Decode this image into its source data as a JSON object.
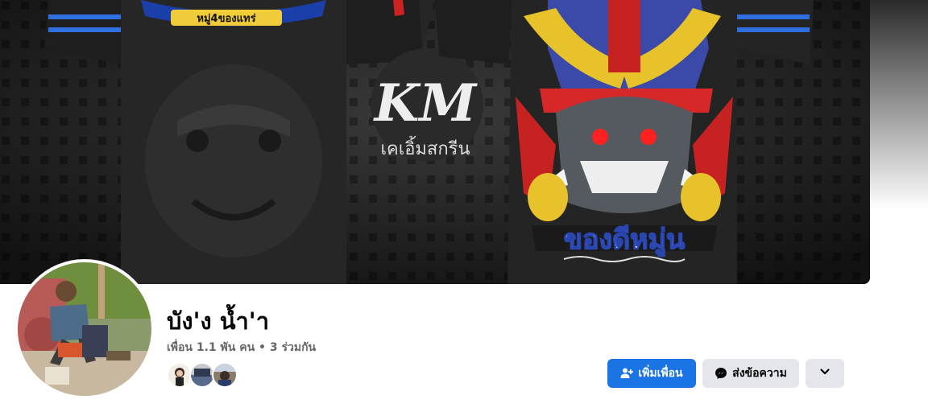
{
  "profile": {
    "name": "บัง'ง น้ำ'า",
    "friends_summary": "เพื่อน 1.1 พัน คน • 3 ร่วมกัน",
    "mutual_friend_count_shown": 3
  },
  "cover": {
    "brand_mark": "KM",
    "brand_caption": "เคเอิ้มสกรีน",
    "shirt_left_tag": "หมู่4ของแทร่",
    "shirt_right_slogan": "ของดีหมู่น"
  },
  "actions": {
    "add_friend_label": "เพิ่มเพื่อน",
    "message_label": "ส่งข้อความ",
    "more_label": ""
  },
  "icons": {
    "add_friend": "add-person-icon",
    "message": "messenger-icon",
    "more": "chevron-down-icon"
  },
  "colors": {
    "primary_button": "#1b74e4",
    "secondary_button": "#e4e6eb",
    "name_text": "#050505",
    "meta_text": "#65676b"
  }
}
